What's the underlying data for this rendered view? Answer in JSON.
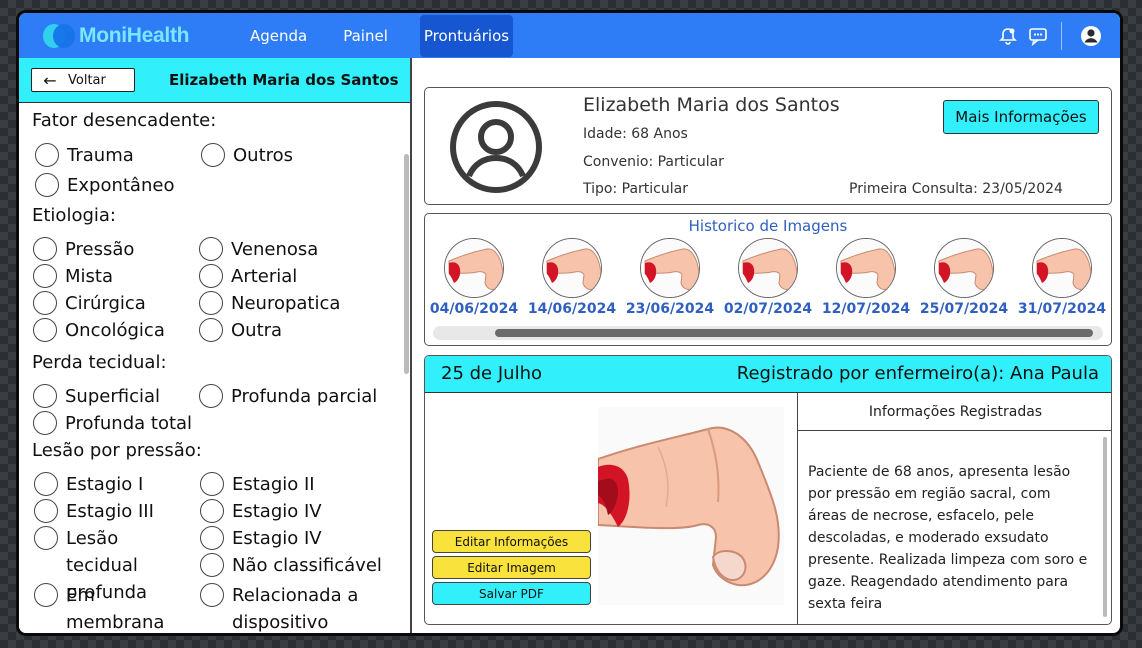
{
  "app": {
    "name": "MoniHealth"
  },
  "nav": {
    "items": [
      {
        "label": "Agenda"
      },
      {
        "label": "Painel"
      },
      {
        "label": "Prontuários",
        "active": true
      }
    ],
    "icons": [
      "bell-icon",
      "chat-icon",
      "user-icon"
    ]
  },
  "sidebar": {
    "back_label": "Voltar",
    "patient_name": "Elizabeth Maria dos Santos",
    "sections": {
      "trigger": {
        "title": "Fator desencadente:",
        "options": [
          "Trauma",
          "Outros",
          "Expontâneo"
        ]
      },
      "etiology": {
        "title": "Etiologia:",
        "options": [
          "Pressão",
          "Venenosa",
          "Mista",
          "Arterial",
          "Cirúrgica",
          "Neuropatica",
          "Oncológica",
          "Outra"
        ]
      },
      "tissue_loss": {
        "title": "Perda tecidual:",
        "options": [
          "Superficial",
          "Profunda parcial",
          "Profunda total"
        ]
      },
      "pressure_injury": {
        "title": "Lesão por pressão:",
        "options": [
          "Estagio I",
          "Estagio II",
          "Estagio III",
          "Estagio IV",
          "Lesão tecidual profunda",
          "Estagio IV",
          "Não classificável",
          "Em membrana mucosa",
          "Relacionada a dispositivo medico"
        ]
      }
    }
  },
  "patient": {
    "name": "Elizabeth Maria dos Santos",
    "age": "Idade: 68 Anos",
    "insurance": "Convenio: Particular",
    "type": "Tipo: Particular",
    "first_visit": "Primeira Consulta: 23/05/2024",
    "more_button": "Mais Informações"
  },
  "history": {
    "title": "Historico de Imagens",
    "dates": [
      "04/06/2024",
      "14/06/2024",
      "23/06/2024",
      "02/07/2024",
      "12/07/2024",
      "25/07/2024",
      "31/07/2024"
    ]
  },
  "record": {
    "date": "25 de Julho",
    "registered_by": "Registrado por enfermeiro(a): Ana Paula",
    "buttons": {
      "edit_info": "Editar Informações",
      "edit_image": "Editar Imagem",
      "save_pdf": "Salvar PDF"
    },
    "info_title": "Informações Registradas",
    "info_text": "Paciente de 68 anos, apresenta lesão por pressão em região sacral, com áreas de necrose, esfacelo, pele descoladas, e moderado exsudato presente. Realizada limpeza com soro e gaze. Reagendado atendimento para sexta feira"
  },
  "colors": {
    "header_blue": "#2f7df6",
    "active_nav": "#1656d1",
    "accent_cyan": "#32f0fb",
    "button_yellow": "#f9e23c",
    "date_blue": "#2f5fbf"
  }
}
